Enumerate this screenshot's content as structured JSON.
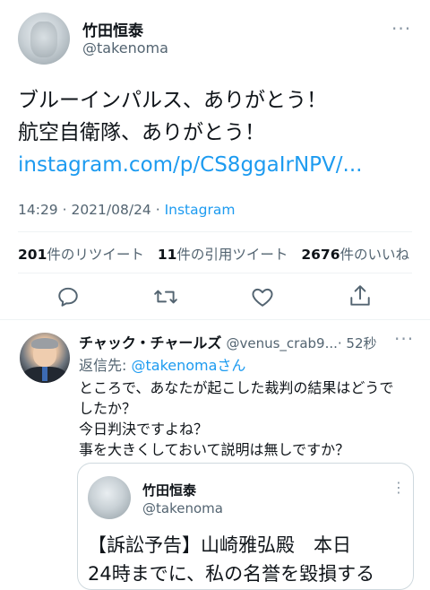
{
  "main_tweet": {
    "author_name": "竹田恒泰",
    "author_handle": "@takenoma",
    "more": "···",
    "text_line1": "ブルーインパルス、ありがとう！",
    "text_line2": "航空自衛隊、ありがとう！",
    "link": "instagram.com/p/CS8ggaIrNPV/...",
    "time": "14:29",
    "date": "2021/08/24",
    "source": "Instagram",
    "sep": " · ",
    "retweets_count": "201",
    "retweets_label": "件のリツイート",
    "quotes_count": "11",
    "quotes_label": "件の引用ツイート",
    "likes_count": "2676",
    "likes_label": "件のいいね"
  },
  "actions": [
    "reply-icon",
    "retweet-icon",
    "like-icon",
    "share-icon"
  ],
  "reply": {
    "author_name": "チャック・チャールズ",
    "author_handle": "@venus_crab9...",
    "time": "· 52秒",
    "more": "···",
    "replying_prefix": "返信先: ",
    "replying_to": "@takenoma",
    "replying_suffix": "さん",
    "line1": "ところで、あなたが起こした裁判の結果はどうで",
    "line2": "したか？",
    "line3": "今日判決ですよね？",
    "line4": "事を大きくしておいて説明は無しですか？"
  },
  "quote": {
    "author_name": "竹田恒泰",
    "author_handle": "@takenoma",
    "more": "⋮",
    "line1": "【訴訟予告】山崎雅弘殿　本日",
    "line2": "24時までに、私の名誉を毀損する"
  },
  "colors": {
    "accent": "#1d9bf0",
    "text": "#0f1419",
    "muted": "#536471",
    "border": "#eff3f4"
  }
}
